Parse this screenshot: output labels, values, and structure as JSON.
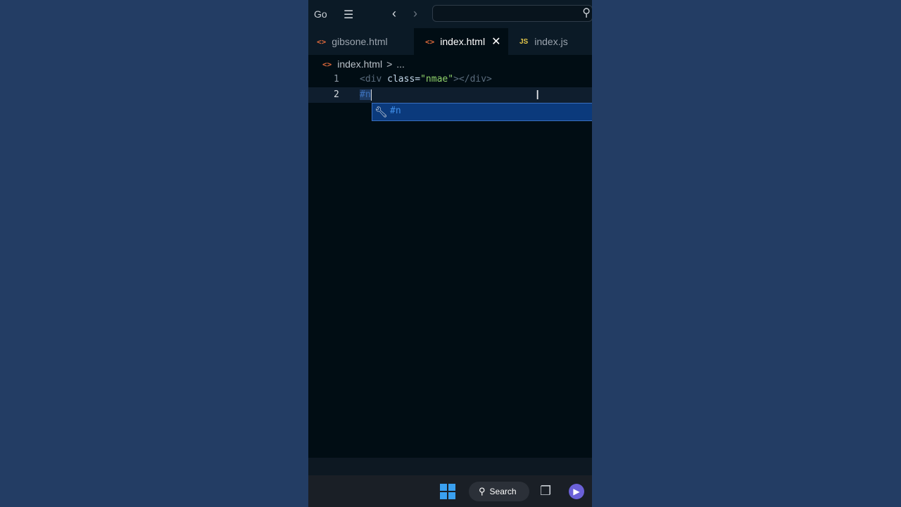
{
  "titlebar": {
    "menu_go": "Go",
    "menu_icon": "hamburger-icon",
    "back_icon": "chevron-left-icon",
    "forward_icon": "chevron-right-icon",
    "search_placeholder": "",
    "search_icon": "search-icon"
  },
  "tabs": [
    {
      "label": "gibsone.html",
      "icon": "html-file-icon",
      "icon_glyph": "<>",
      "active": false
    },
    {
      "label": "index.html",
      "icon": "html-file-icon",
      "icon_glyph": "<>",
      "active": true,
      "close": "✕"
    },
    {
      "label": "index.js",
      "icon": "js-file-icon",
      "icon_glyph": "JS",
      "active": false
    }
  ],
  "breadcrumb": {
    "icon_glyph": "<>",
    "file": "index.html",
    "separator": ">",
    "rest": "..."
  },
  "editor": {
    "lines": [
      {
        "number": "1",
        "open_bracket": "<",
        "tag": "div",
        "attr": " class=",
        "value": "\"nmae\"",
        "close": "></",
        "close_tag": "div",
        "end": ">"
      },
      {
        "number": "2",
        "typed": "#n"
      }
    ]
  },
  "suggestion": {
    "icon": "wrench-icon",
    "label": "#n"
  },
  "taskbar": {
    "start_icon": "windows-logo-icon",
    "search_label": "Search",
    "taskview_icon": "task-view-icon",
    "teams_icon": "teams-icon"
  },
  "colors": {
    "background": "#233d64",
    "editor_bg": "#010d14",
    "string": "#8fd16a",
    "suggestion_bg": "#0b3a7c"
  }
}
